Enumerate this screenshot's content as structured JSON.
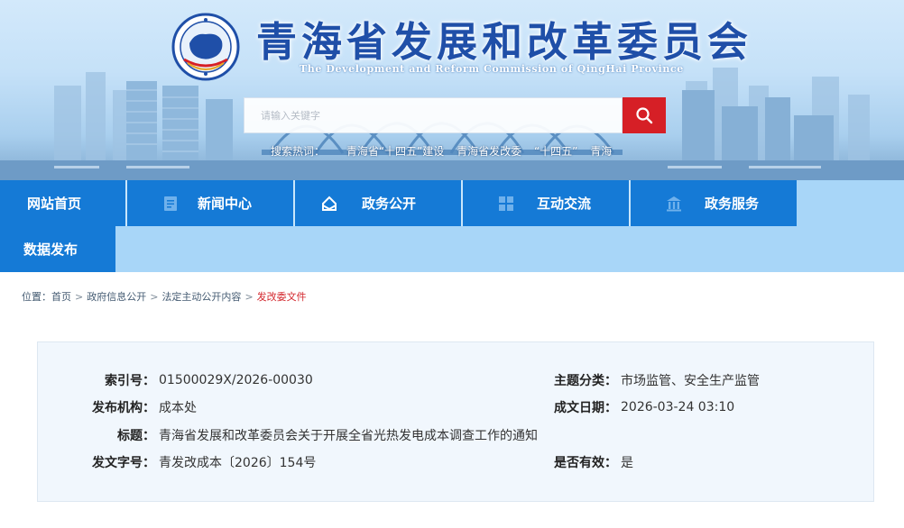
{
  "header": {
    "title": "青海省发展和改革委员会",
    "subtitle": "The Development and Reform Commission of QingHai Province"
  },
  "search": {
    "placeholder": "请输入关键字",
    "hot_label": "搜索热词：",
    "hot_words": [
      "青海省“十四五”建设",
      "青海省发改委",
      "“十四五”",
      "青海"
    ]
  },
  "nav": {
    "items": [
      {
        "label": "网站首页",
        "icon": "none"
      },
      {
        "label": "新闻中心",
        "icon": "document-icon"
      },
      {
        "label": "政务公开",
        "icon": "open-box-icon"
      },
      {
        "label": "互动交流",
        "icon": "grid-icon"
      },
      {
        "label": "政务服务",
        "icon": "building-icon"
      },
      {
        "label": "数据发布",
        "icon": "none"
      }
    ]
  },
  "breadcrumb": {
    "prefix": "位置：",
    "items": [
      "首页",
      "政府信息公开",
      "法定主动公开内容",
      "发改委文件"
    ],
    "separator": ">"
  },
  "document_meta": {
    "index_no": {
      "key": "索引号：",
      "value": "01500029X/2026-00030"
    },
    "topic": {
      "key": "主题分类：",
      "value": "市场监管、安全生产监管"
    },
    "publisher": {
      "key": "发布机构：",
      "value": "成本处"
    },
    "date": {
      "key": "成文日期：",
      "value": "2026-03-24 03:10"
    },
    "title": {
      "key": "标题：",
      "value": "青海省发展和改革委员会关于开展全省光热发电成本调查工作的通知"
    },
    "doc_no": {
      "key": "发文字号：",
      "value": "青发改成本〔2026〕154号"
    },
    "valid": {
      "key": "是否有效：",
      "value": "是"
    }
  },
  "colors": {
    "nav_blue": "#157ad6",
    "nav_strip": "#a8d6f8",
    "search_red": "#d61f26",
    "title_blue": "#1f4fa8",
    "breadcrumb_current": "#d3282e",
    "meta_bg": "#f1f7fd"
  }
}
